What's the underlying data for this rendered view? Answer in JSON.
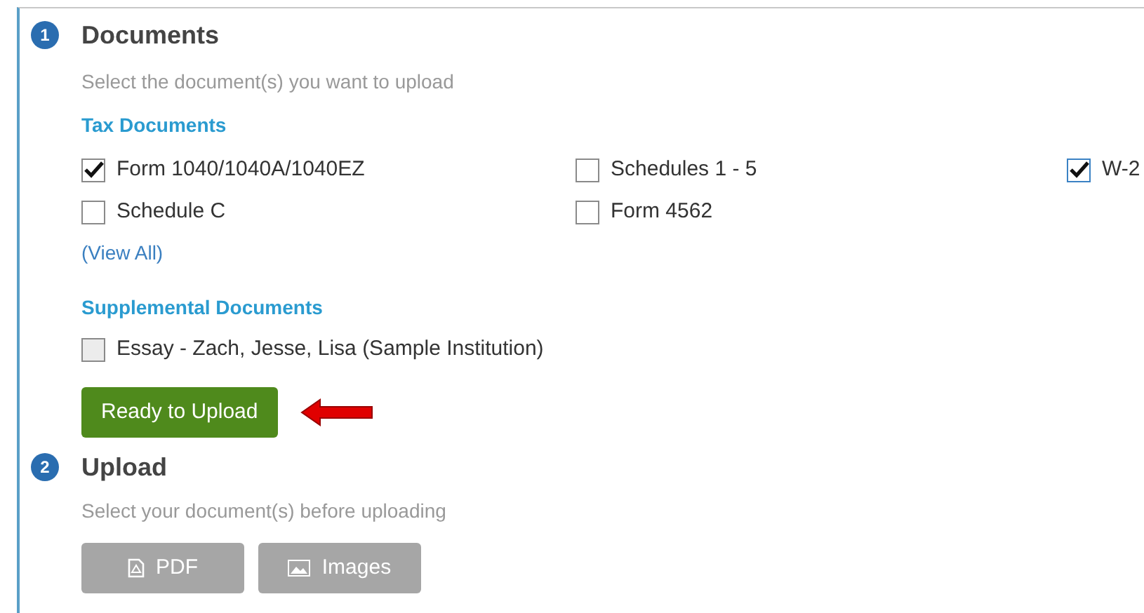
{
  "steps": [
    {
      "number": "1",
      "title": "Documents",
      "subtitle": "Select the document(s) you want to upload"
    },
    {
      "number": "2",
      "title": "Upload",
      "subtitle": "Select your document(s) before uploading"
    }
  ],
  "tax_documents": {
    "heading": "Tax Documents",
    "items": [
      {
        "label": "Form 1040/1040A/1040EZ",
        "checked": true,
        "focused": false,
        "disabled": false
      },
      {
        "label": "Schedules 1 - 5",
        "checked": false,
        "focused": false,
        "disabled": false
      },
      {
        "label": "W-2",
        "checked": true,
        "focused": true,
        "disabled": false
      },
      {
        "label": "Schedule C",
        "checked": false,
        "focused": false,
        "disabled": false
      },
      {
        "label": "Form 4562",
        "checked": false,
        "focused": false,
        "disabled": false
      }
    ],
    "view_all": "(View All)"
  },
  "supplemental_documents": {
    "heading": "Supplemental Documents",
    "items": [
      {
        "label": "Essay - Zach, Jesse, Lisa (Sample Institution)",
        "checked": false,
        "focused": false,
        "disabled": true
      }
    ]
  },
  "ready_button": "Ready to Upload",
  "upload_buttons": [
    {
      "kind": "pdf",
      "label": "PDF",
      "disabled": true
    },
    {
      "kind": "images",
      "label": "Images",
      "disabled": true
    }
  ]
}
